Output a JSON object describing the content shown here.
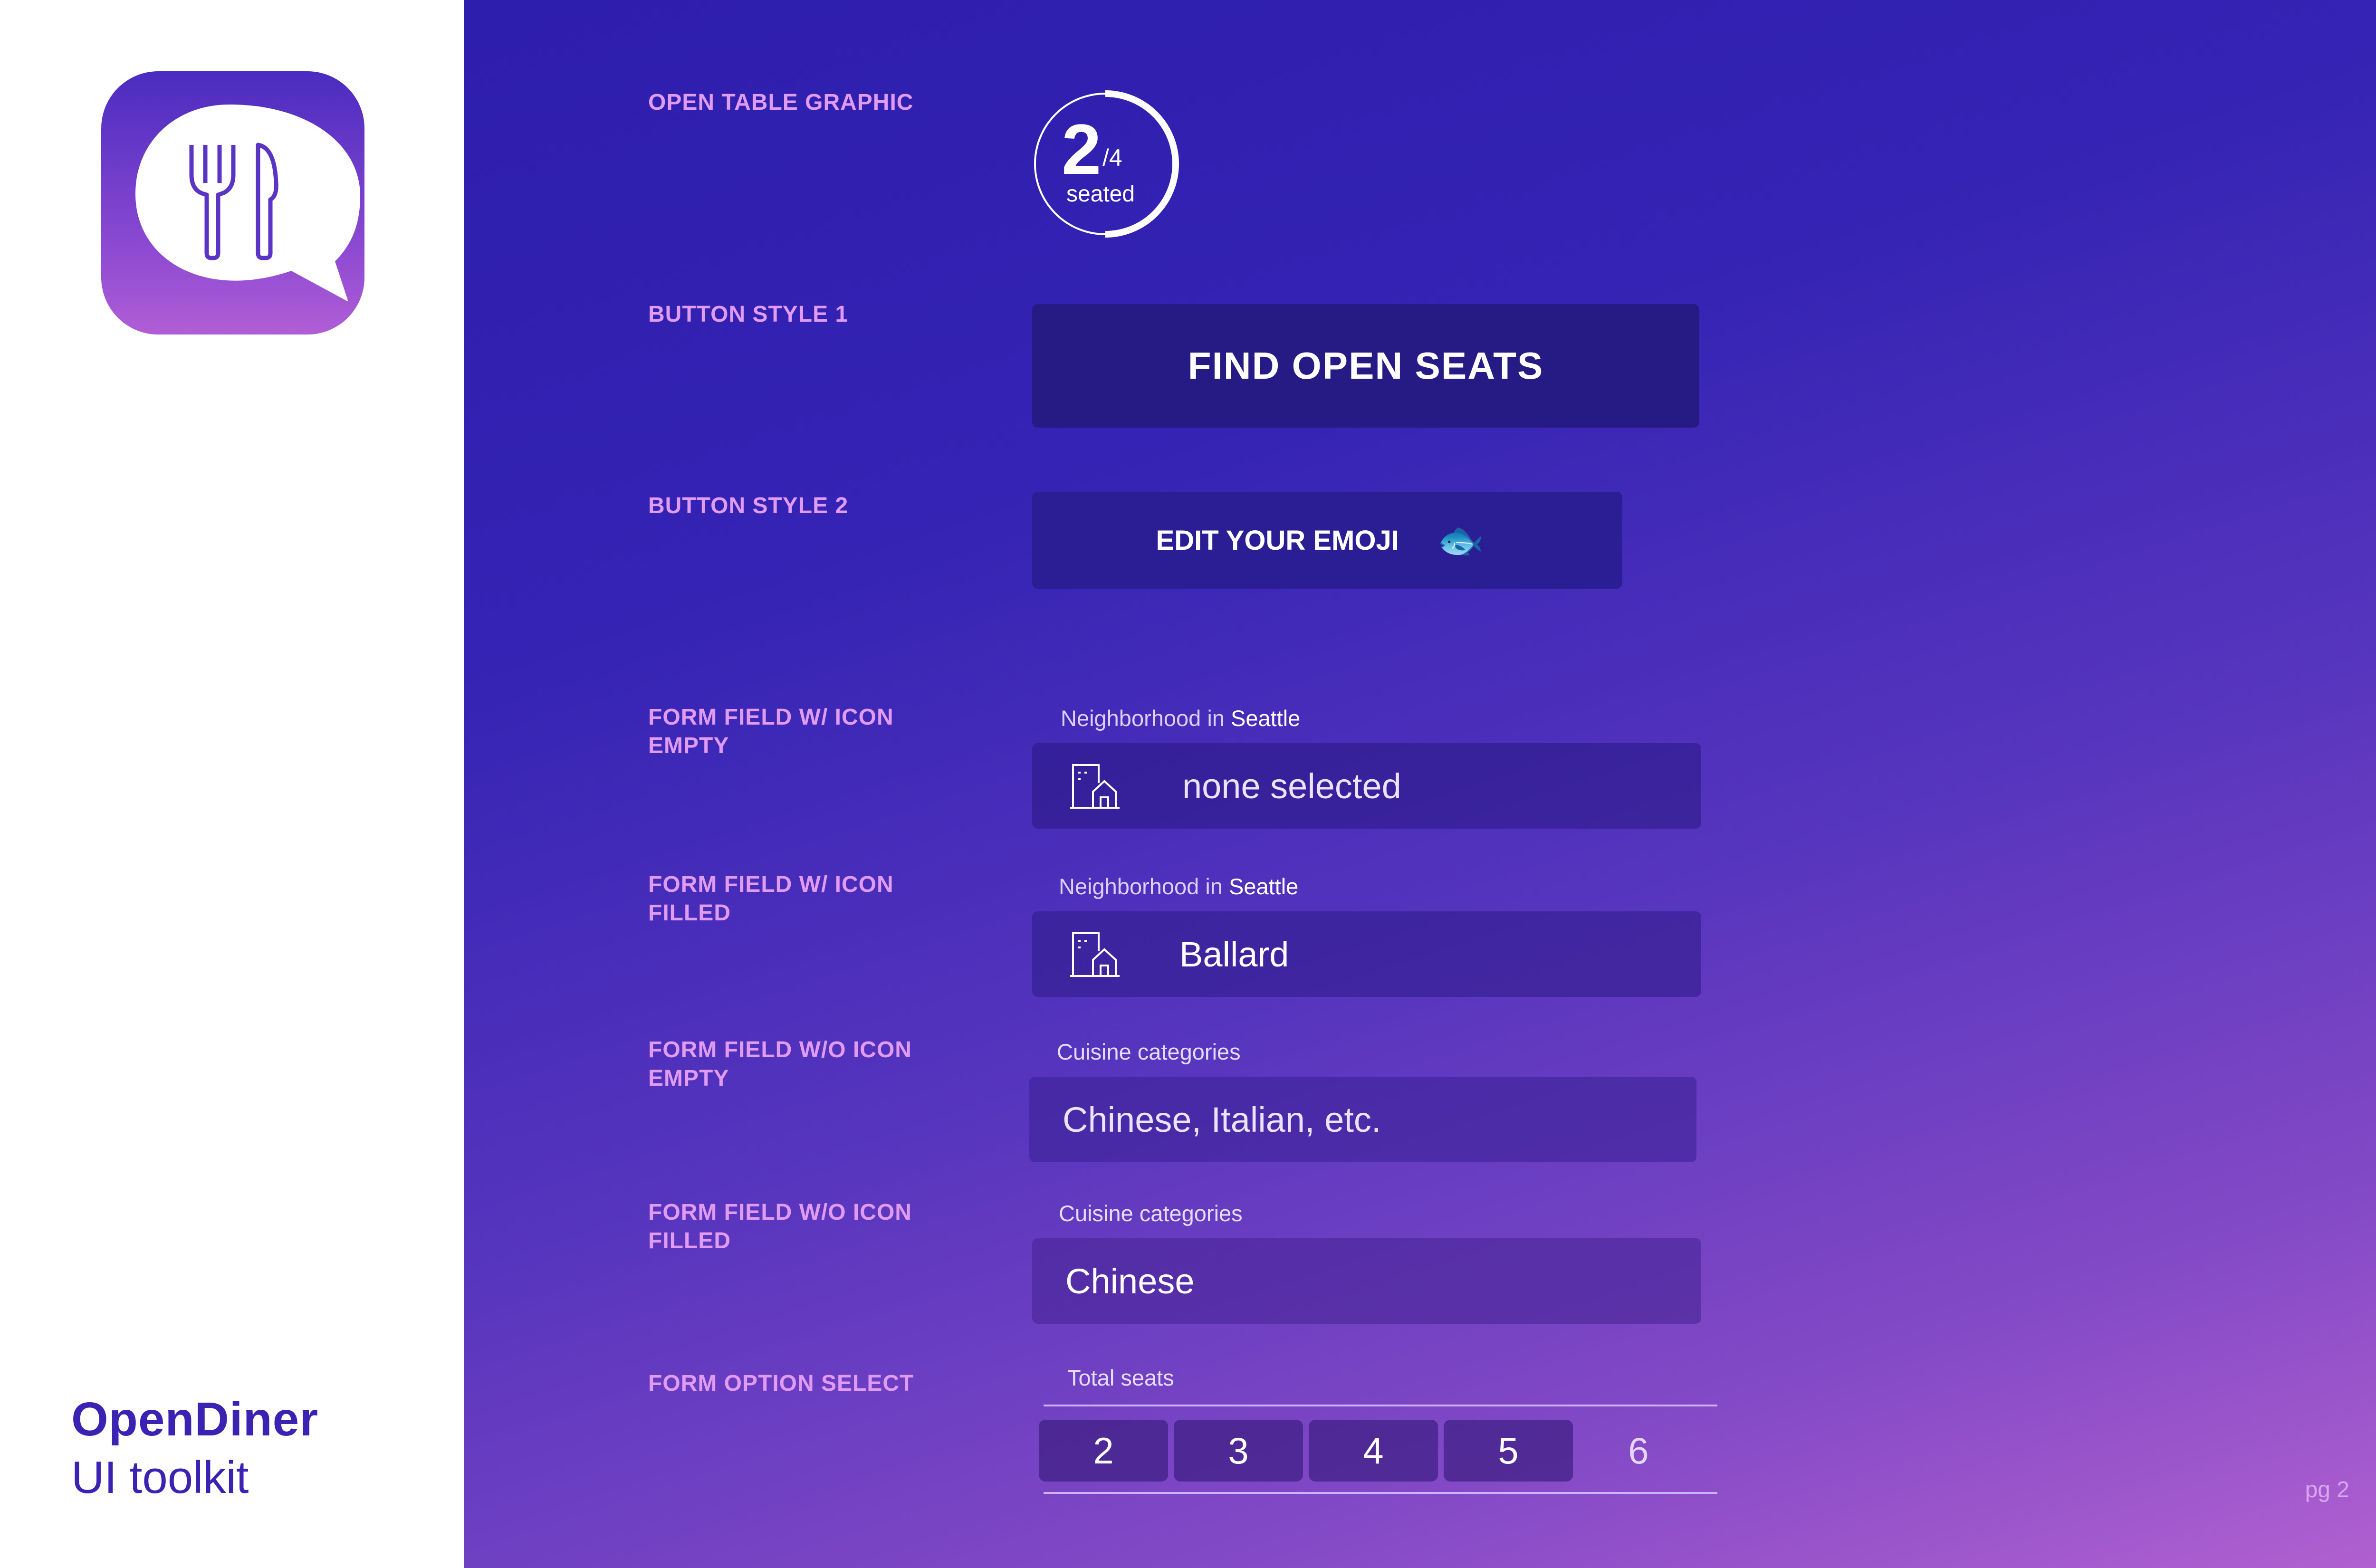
{
  "brand": {
    "name": "OpenDiner",
    "subtitle": "UI toolkit",
    "accent": "#3b22b3"
  },
  "app_icon": {
    "icon": "speech-bubble-fork-knife-icon"
  },
  "open_table_graphic": {
    "label": "OPEN TABLE GRAPHIC",
    "seated_count": "2",
    "total": "/4",
    "caption": "seated",
    "fraction_filled": 0.5
  },
  "button_style_1": {
    "label": "BUTTON STYLE 1",
    "text": "FIND OPEN SEATS",
    "color": "#261a84"
  },
  "button_style_2": {
    "label": "BUTTON STYLE 2",
    "text": "EDIT YOUR EMOJI",
    "emoji": "🐟",
    "color": "#2b1e95"
  },
  "form_icon_empty": {
    "label_line1": "FORM FIELD W/ ICON",
    "label_line2": "EMPTY",
    "caption_prefix": "Neighborhood in",
    "caption_city": "Seattle",
    "placeholder": "none selected",
    "icon": "building-home-icon"
  },
  "form_icon_filled": {
    "label_line1": "FORM FIELD W/ ICON",
    "label_line2": "FILLED",
    "caption_prefix": "Neighborhood in",
    "caption_city": "Seattle",
    "value": "Ballard",
    "icon": "building-home-icon"
  },
  "form_noicon_empty": {
    "label_line1": "FORM FIELD W/O ICON",
    "label_line2": "EMPTY",
    "caption": "Cuisine categories",
    "placeholder": "Chinese, Italian, etc."
  },
  "form_noicon_filled": {
    "label_line1": "FORM FIELD W/O ICON",
    "label_line2": "FILLED",
    "caption": "Cuisine categories",
    "value": "Chinese"
  },
  "form_option_select": {
    "label": "FORM OPTION SELECT",
    "caption": "Total seats",
    "options": [
      "2",
      "3",
      "4",
      "5",
      "6"
    ],
    "selected_count": 4
  },
  "page_number": "pg 2",
  "colors": {
    "label": "#e29bf2",
    "field_bg": "rgba(40,24,130,0.55)",
    "option_bg": "rgba(60,30,130,0.7)"
  }
}
